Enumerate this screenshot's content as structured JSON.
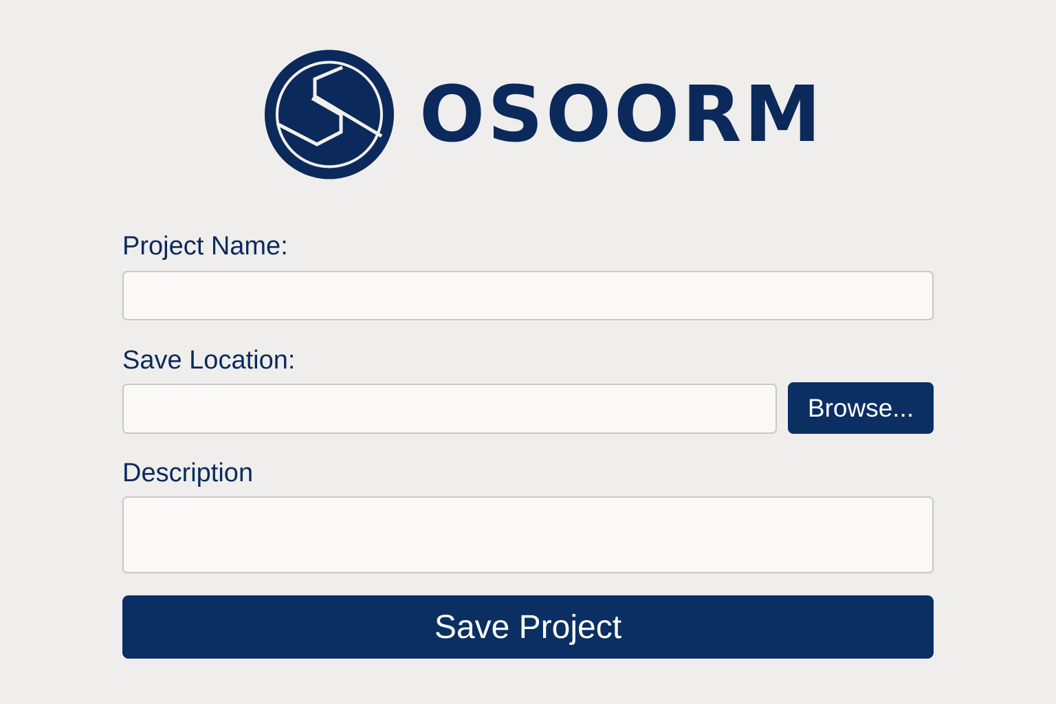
{
  "brand": {
    "name": "OSOORM",
    "logo_icon": "hexagon-swirl-logo-icon",
    "color": "#0b2a5b"
  },
  "form": {
    "project_name": {
      "label": "Project Name:",
      "value": "",
      "placeholder": ""
    },
    "save_location": {
      "label": "Save Location:",
      "value": "",
      "placeholder": "",
      "browse_label": "Browse..."
    },
    "description": {
      "label": "Description",
      "value": "",
      "placeholder": ""
    },
    "submit_label": "Save Project"
  },
  "colors": {
    "background": "#efeeec",
    "primary": "#0b2f63",
    "input_background": "#faf9f7",
    "input_border": "#c8c8c8"
  }
}
